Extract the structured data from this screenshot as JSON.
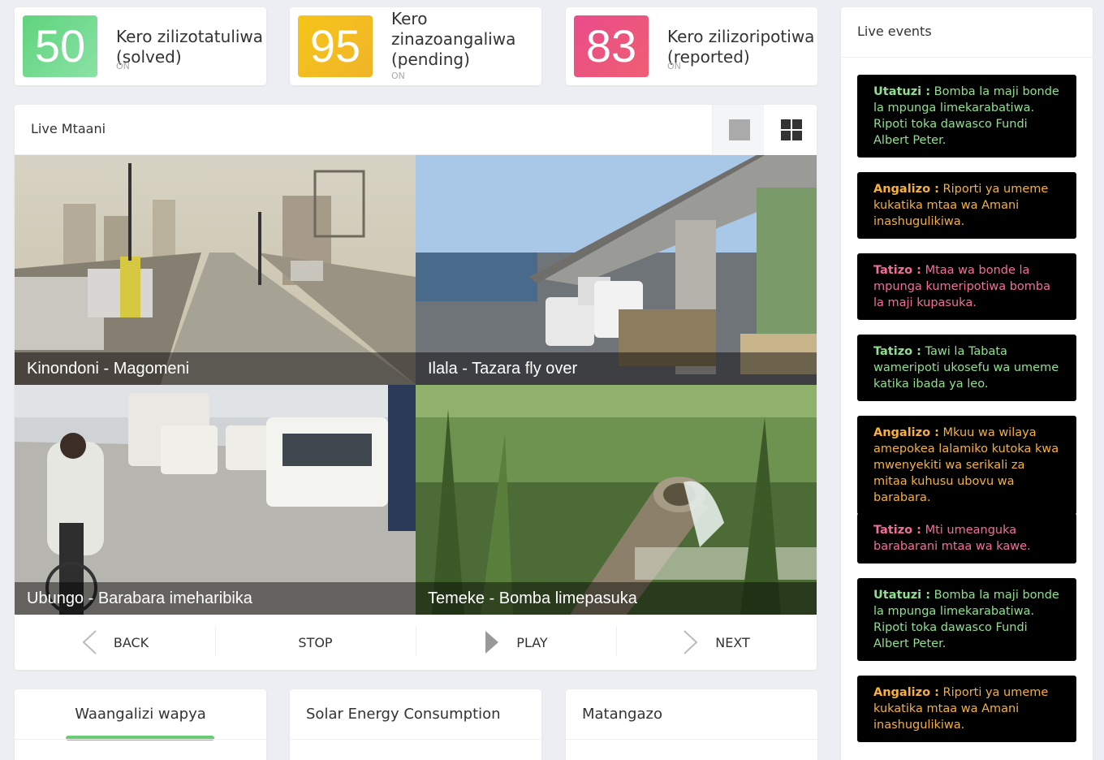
{
  "stats": [
    {
      "number": "50",
      "title_line1": "Kero zilizotatuliwa",
      "title_line2": "(solved)",
      "sub": "ON"
    },
    {
      "number": "95",
      "title_line1": "Kero",
      "title_line2": "zinazoangaliwa",
      "title_line3": "(pending)",
      "sub": "ON"
    },
    {
      "number": "83",
      "title_line1": "Kero zilizoripotiwa",
      "title_line2": "(reported)",
      "sub": "ON"
    }
  ],
  "live": {
    "title": "Live Mtaani",
    "tiles": [
      {
        "label": "Kinondoni - Magomeni"
      },
      {
        "label": "Ilala - Tazara fly over"
      },
      {
        "label": "Ubungo - Barabara imeharibika"
      },
      {
        "label": "Temeke - Bomba limepasuka"
      }
    ],
    "controls": {
      "back": "BACK",
      "stop": "STOP",
      "play": "PLAY",
      "next": "NEXT"
    }
  },
  "bottom": {
    "waangalizi": "Waangalizi wapya",
    "solar": "Solar Energy Consumption",
    "matangazo": "Matangazo"
  },
  "events": {
    "title": "Live events",
    "items": [
      {
        "tag": "Utatuzi :",
        "text": " Bomba la maji bonde la mpunga limekarabatiwa. Ripoti toka dawasco Fundi Albert Peter.",
        "kind": "green"
      },
      {
        "tag": "Angalizo :",
        "text": " Riporti ya umeme kukatika mtaa wa Amani inashugulikiwa.",
        "kind": "orange"
      },
      {
        "tag": "Tatizo :",
        "text": " Mtaa wa bonde la mpunga kumeripotiwa bomba la maji kupasuka.",
        "kind": "pink"
      },
      {
        "tag": "Tatizo :",
        "text": " Tawi la Tabata wameripoti ukosefu wa umeme katika ibada ya leo.",
        "kind": "green"
      },
      {
        "tag": "Angalizo :",
        "text": " Mkuu wa wilaya amepokea lalamiko kutoka kwa mwenyekiti wa serikali za mitaa kuhusu ubovu wa barabara.",
        "kind": "orange"
      },
      {
        "tag": "Tatizo :",
        "text": " Mti umeanguka barabarani mtaa wa kawe.",
        "kind": "pink"
      },
      {
        "tag": "Utatuzi :",
        "text": " Bomba la maji bonde la mpunga limekarabatiwa. Ripoti toka dawasco Fundi Albert Peter.",
        "kind": "green"
      },
      {
        "tag": "Angalizo :",
        "text": " Riporti ya umeme kukatika mtaa wa Amani inashugulikiwa.",
        "kind": "orange"
      }
    ]
  }
}
